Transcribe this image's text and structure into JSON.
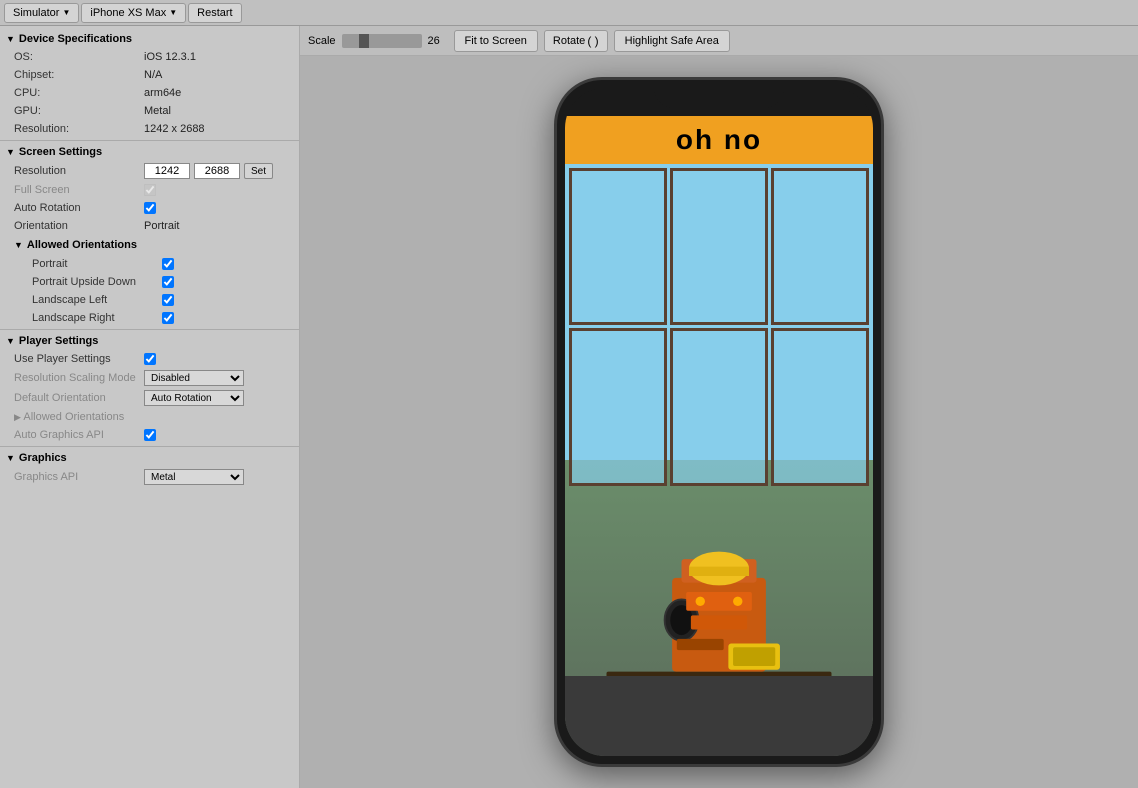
{
  "topbar": {
    "simulator_label": "Simulator",
    "device_label": "iPhone XS Max",
    "restart_label": "Restart"
  },
  "toolbar": {
    "scale_label": "Scale",
    "scale_value": "26",
    "fit_to_screen_label": "Fit to Screen",
    "rotate_label": "Rotate",
    "rotate_icon": "↺",
    "highlight_safe_area_label": "Highlight Safe Area"
  },
  "left_panel": {
    "device_specs_header": "Device Specifications",
    "os_label": "OS:",
    "os_value": "iOS 12.3.1",
    "chipset_label": "Chipset:",
    "chipset_value": "N/A",
    "cpu_label": "CPU:",
    "cpu_value": "arm64e",
    "gpu_label": "GPU:",
    "gpu_value": "Metal",
    "resolution_label": "Resolution:",
    "resolution_value": "1242 x 2688",
    "screen_settings_header": "Screen Settings",
    "resolution_field_label": "Resolution",
    "res_width": "1242",
    "res_height": "2688",
    "set_btn_label": "Set",
    "full_screen_label": "Full Screen",
    "auto_rotation_label": "Auto Rotation",
    "orientation_label": "Orientation",
    "orientation_value": "Portrait",
    "allowed_orientations_header": "Allowed Orientations",
    "portrait_label": "Portrait",
    "portrait_upside_down_label": "Portrait Upside Down",
    "landscape_left_label": "Landscape Left",
    "landscape_right_label": "Landscape Right",
    "player_settings_header": "Player Settings",
    "use_player_settings_label": "Use Player Settings",
    "resolution_scaling_mode_label": "Resolution Scaling Mode",
    "resolution_scaling_value": "Disabled",
    "default_orientation_label": "Default Orientation",
    "default_orientation_value": "Auto Rotation",
    "allowed_orientations_2_label": "Allowed Orientations",
    "auto_graphics_api_label": "Auto Graphics API",
    "graphics_header": "Graphics",
    "graphics_api_label": "Graphics API",
    "graphics_api_value": "Metal"
  },
  "game": {
    "header_text": "oh no"
  }
}
